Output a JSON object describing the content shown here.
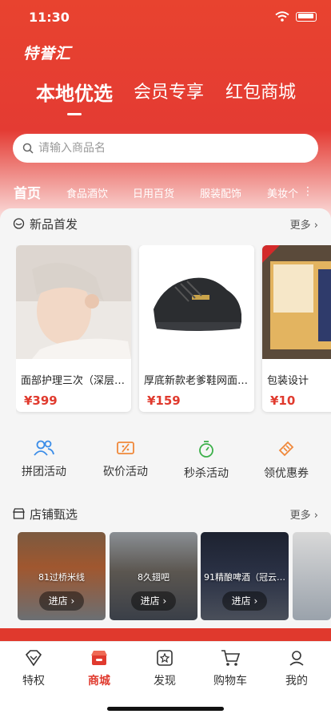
{
  "status": {
    "time": "11:30"
  },
  "brand": "特誉汇",
  "top_tabs": [
    {
      "label": "本地优选",
      "active": true
    },
    {
      "label": "会员专享",
      "active": false
    },
    {
      "label": "红包商城",
      "active": false
    }
  ],
  "search": {
    "placeholder": "请输入商品名"
  },
  "categories": [
    {
      "label": "首页",
      "active": true
    },
    {
      "label": "食品酒饮"
    },
    {
      "label": "日用百货"
    },
    {
      "label": "服装配饰"
    },
    {
      "label": "美妆个"
    }
  ],
  "new_products": {
    "title": "新品首发",
    "more": "更多",
    "items": [
      {
        "name": "面部护理三次（深层…",
        "price": "¥399"
      },
      {
        "name": "厚底新款老爹鞋网面…",
        "price": "¥159"
      },
      {
        "name": "包装设计",
        "price": "¥10"
      }
    ]
  },
  "actions": [
    {
      "label": "拼团活动",
      "icon": "group-icon",
      "color": "#3b8de8"
    },
    {
      "label": "砍价活动",
      "icon": "bargain-icon",
      "color": "#f0883a"
    },
    {
      "label": "秒杀活动",
      "icon": "stopwatch-icon",
      "color": "#3cb04a"
    },
    {
      "label": "领优惠券",
      "icon": "coupon-icon",
      "color": "#f0883a"
    }
  ],
  "stores": {
    "title": "店铺甄选",
    "more": "更多",
    "items": [
      {
        "name": "81过桥米线",
        "enter": "进店"
      },
      {
        "name": "8久翅吧",
        "enter": "进店"
      },
      {
        "name": "91精酿啤酒（冠云…",
        "enter": "进店"
      }
    ]
  },
  "tabbar": [
    {
      "label": "特权",
      "icon": "diamond-icon"
    },
    {
      "label": "商城",
      "icon": "shop-icon",
      "active": true
    },
    {
      "label": "发现",
      "icon": "discover-icon"
    },
    {
      "label": "购物车",
      "icon": "cart-icon"
    },
    {
      "label": "我的",
      "icon": "profile-icon"
    }
  ],
  "colors": {
    "brand_red": "#e03a2e",
    "header_red": "#e8432f"
  }
}
